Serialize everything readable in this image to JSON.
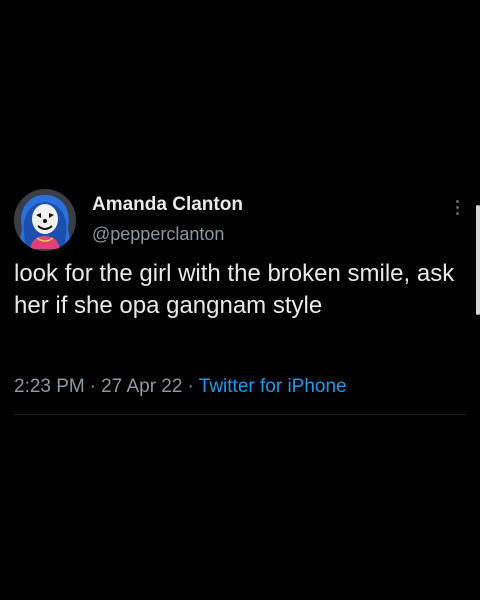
{
  "tweet": {
    "author": {
      "display_name": "Amanda Clanton",
      "handle": "@pepperclanton",
      "avatar_icon": "clown-avatar"
    },
    "text": "look for the girl with the broken smile, ask her if she opa gangnam style",
    "time": "2:23 PM",
    "separator": "·",
    "date": "27 Apr 22",
    "source": "Twitter for iPhone",
    "more_icon": "more-options-icon"
  },
  "colors": {
    "background": "#000000",
    "primary_text": "#e7e9ea",
    "secondary_text": "#8b98a5",
    "link": "#1d9bf0"
  }
}
